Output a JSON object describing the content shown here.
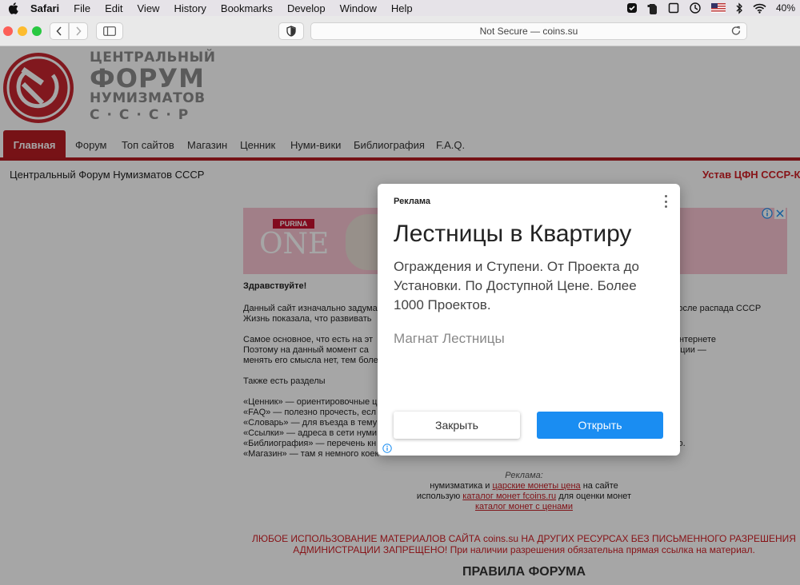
{
  "menubar": {
    "app": "Safari",
    "items": [
      "File",
      "Edit",
      "View",
      "History",
      "Bookmarks",
      "Develop",
      "Window",
      "Help"
    ],
    "battery": "40%"
  },
  "browser": {
    "address": "Not Secure — coins.su"
  },
  "site": {
    "logo": {
      "line1": "ЦЕНТРАЛЬНЫЙ",
      "line2": "ФОРУМ",
      "line3": "НУМИЗМАТОВ",
      "line4": "С·С·С·Р"
    },
    "nav": {
      "active": "Главная",
      "items": [
        "Форум",
        "Топ сайтов",
        "Магазин",
        "Ценник",
        "Нуми-вики",
        "Библиография",
        "F.A.Q."
      ]
    },
    "title": "Центральный Форум Нумизматов СССР",
    "charter_link": "Устав ЦФН СССР-Кр",
    "banner": {
      "brand": "PURINA",
      "product": "ONE"
    },
    "content": {
      "greeting": "Здравствуйте!",
      "p1_line1": "Данный сайт изначально задуманный                                                                                                     шихся после распада СССР",
      "p1_line2": "Жизнь показала, что развивать",
      "p2_line1": "Самое основное, что есть на эт                                                                                            нумизматическом Интернете",
      "p2_line2": "Поэтому на данный момент са                                                                                            лся от старой концепции —",
      "p2_line3": "менять его смысла нет, тем боле",
      "sections_title": "Также есть разделы",
      "s1": "«Ценник» — ориентировочные ц",
      "s2": "«FAQ» — полезно прочесть, есл",
      "s3": "«Словарь» — для въезда в тему",
      "s4": "«Ссылки» — адреса в сети нуми",
      "s5": "«Библиография» — перечень кн                                                                                            й профессионально.",
      "s6": "«Магазин» — там я немного коек"
    },
    "ad_footer": {
      "label": "Реклама:",
      "l1_pre": "нумизматика и ",
      "l1_link": "царские монеты цена",
      "l1_post": " на сайте",
      "l2_pre": "использую ",
      "l2_link": "каталог монет fcoins.ru",
      "l2_post": " для оценки монет",
      "l3_link": "каталог монет с ценами"
    },
    "warning": "ЛЮБОЕ ИСПОЛЬЗОВАНИЕ МАТЕРИАЛОВ САЙТА coins.su НА ДРУГИХ РЕСУРСАХ БЕЗ ПИСЬМЕННОГО РАЗРЕШЕНИЯ АДМИНИСТРАЦИИ ЗАПРЕЩЕНО! При наличии разрешения обязательна прямая ссылка на материал.",
    "rules_heading": "ПРАВИЛА ФОРУМА"
  },
  "modal": {
    "ad_tag": "Реклама",
    "headline": "Лестницы в Квартиру",
    "description": "Ограждения и Ступени. От Проекта до Установки. По Доступной Цене. Более 1000 Проектов.",
    "advertiser": "Магнат Лестницы",
    "close_label": "Закрыть",
    "open_label": "Открыть",
    "accent": "#1a8df2"
  }
}
